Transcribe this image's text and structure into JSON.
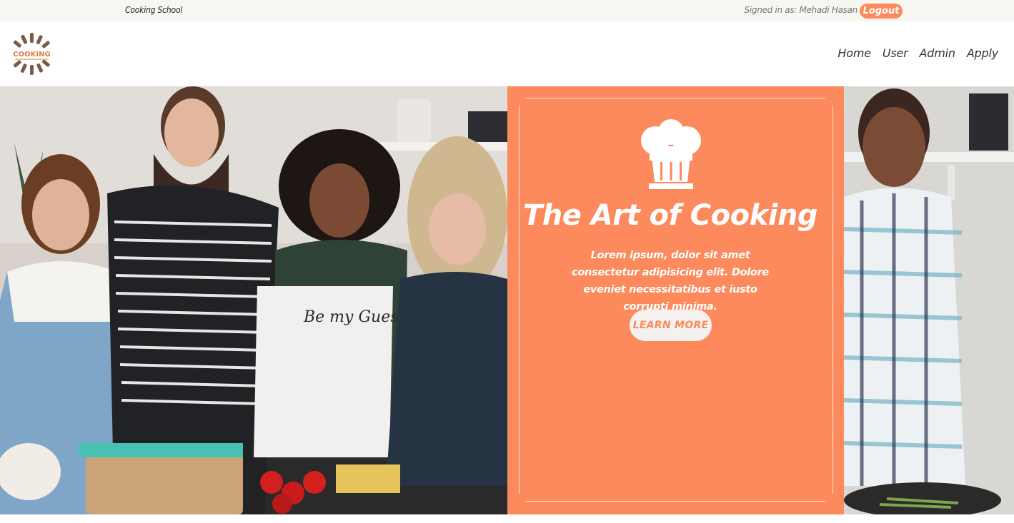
{
  "topbar": {
    "site_name": "Cooking School",
    "signed_in": "Signed in as: Mehadi Hasan",
    "logout_label": "Logout"
  },
  "header": {
    "logo_text": "COOKING",
    "nav": [
      {
        "label": "Home"
      },
      {
        "label": "User"
      },
      {
        "label": "Admin"
      },
      {
        "label": "Apply"
      }
    ]
  },
  "hero": {
    "icon": "chef-hat-icon",
    "title": "The Art of Cooking",
    "description": "Lorem ipsum, dolor sit amet consectetur adipisicing elit. Dolore eveniet necessitatibus et iusto corrupti minima.",
    "button_label": "LEARN MORE",
    "apron_text": "Be my Guest"
  },
  "colors": {
    "accent": "#fc8a5c",
    "topbar_bg": "#f8f6f1",
    "button_bg": "#f4f1ee"
  }
}
